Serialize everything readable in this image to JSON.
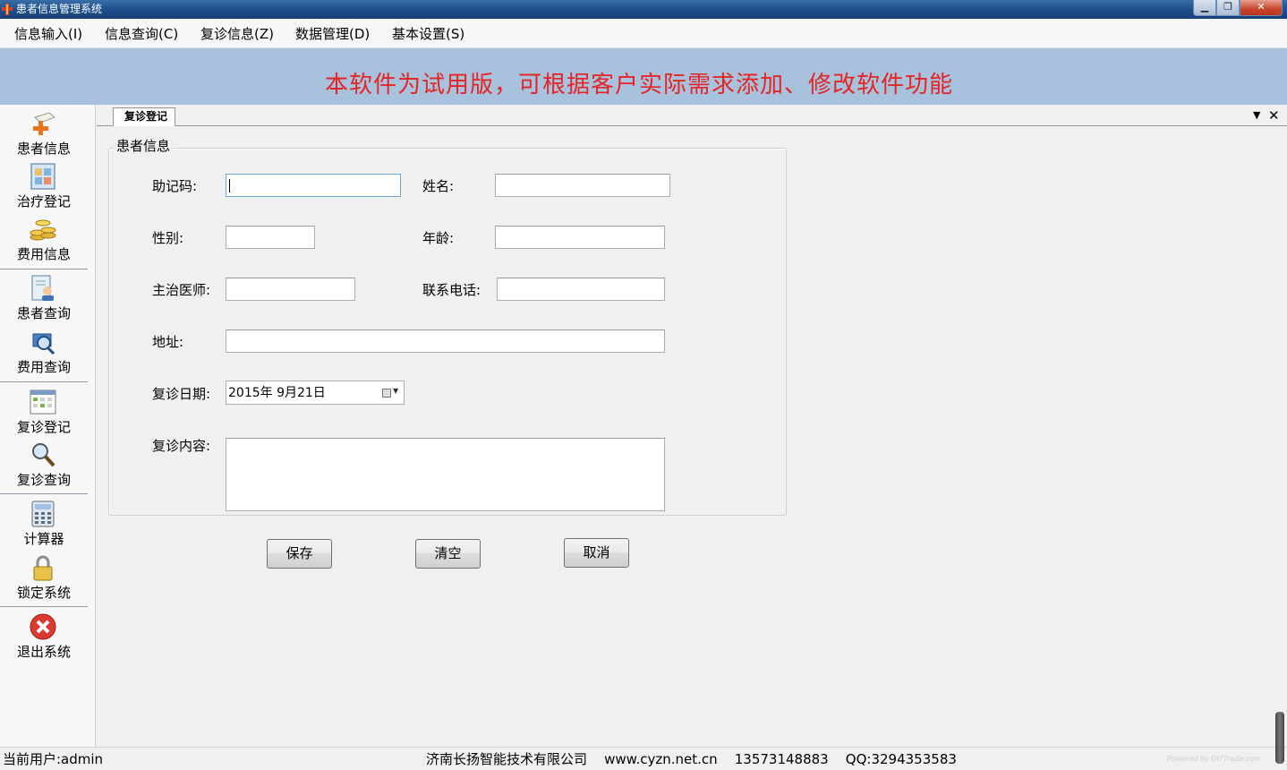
{
  "window": {
    "title": "患者信息管理系统",
    "controls": {
      "minimize": "▁",
      "maximize": "❐",
      "close": "✕"
    }
  },
  "menu": [
    {
      "label": "信息输入(I)"
    },
    {
      "label": "信息查询(C)"
    },
    {
      "label": "复诊信息(Z)"
    },
    {
      "label": "数据管理(D)"
    },
    {
      "label": "基本设置(S)"
    }
  ],
  "banner": {
    "text": "本软件为试用版，可根据客户实际需求添加、修改软件功能",
    "color": "#e52424"
  },
  "sidebar": {
    "items": [
      {
        "label": "患者信息",
        "icon": "patient-add-icon"
      },
      {
        "label": "治疗登记",
        "icon": "treatment-register-icon"
      },
      {
        "label": "费用信息",
        "icon": "coins-icon"
      },
      {
        "label": "患者查询",
        "icon": "patient-search-icon"
      },
      {
        "label": "费用查询",
        "icon": "fee-search-icon"
      },
      {
        "label": "复诊登记",
        "icon": "calendar-icon"
      },
      {
        "label": "复诊查询",
        "icon": "magnifier-icon"
      },
      {
        "label": "计算器",
        "icon": "calculator-icon"
      },
      {
        "label": "锁定系统",
        "icon": "lock-icon"
      },
      {
        "label": "退出系统",
        "icon": "exit-icon"
      }
    ]
  },
  "tab": {
    "label": "复诊登记",
    "dropdown": "▼",
    "close": "✕"
  },
  "form": {
    "group_title": "患者信息",
    "mnemonic_label": "助记码:",
    "name_label": "姓名:",
    "gender_label": "性别:",
    "age_label": "年龄:",
    "doctor_label": "主治医师:",
    "phone_label": "联系电话:",
    "address_label": "地址:",
    "date_label": "复诊日期:",
    "date_value": "2015年  9月21日",
    "content_label": "复诊内容:",
    "mnemonic_value": "",
    "name_value": "",
    "gender_value": "",
    "age_value": "",
    "doctor_value": "",
    "phone_value": "",
    "address_value": "",
    "content_value": ""
  },
  "buttons": {
    "save": "保存",
    "clear": "清空",
    "cancel": "取消"
  },
  "status": {
    "user": "当前用户:admin",
    "company": "济南长扬智能技术有限公司    www.cyzn.net.cn    13573148883    QQ:3294353583",
    "watermark": "Powered by DIYTrade.com"
  }
}
